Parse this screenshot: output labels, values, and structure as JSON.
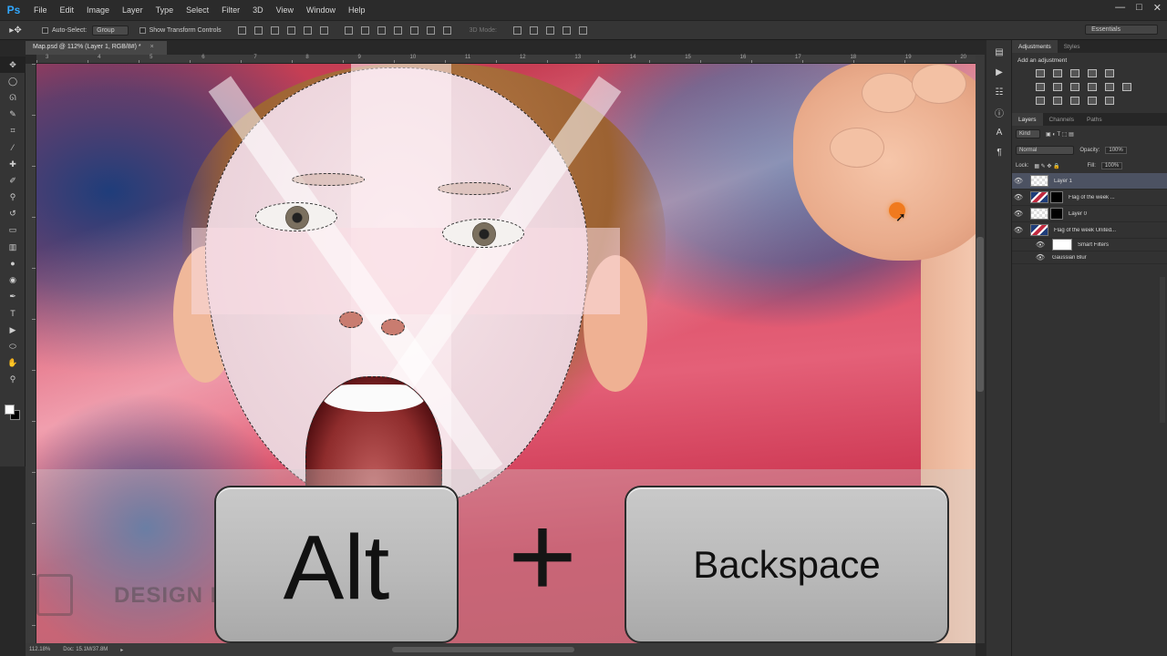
{
  "app": {
    "logo": "Ps"
  },
  "menu": [
    "File",
    "Edit",
    "Image",
    "Layer",
    "Type",
    "Select",
    "Filter",
    "3D",
    "View",
    "Window",
    "Help"
  ],
  "window_controls": [
    "—",
    "□",
    "✕"
  ],
  "options": {
    "auto_select_label": "Auto-Select:",
    "auto_select_value": "Group",
    "show_transform_label": "Show Transform Controls",
    "mode_3d_label": "3D Mode:",
    "workspace": "Essentials"
  },
  "document": {
    "tab_title": "Map.psd @ 112% (Layer 1, RGB/8#) *",
    "tab_close": "×"
  },
  "ruler": {
    "numbers": [
      "3",
      "4",
      "5",
      "6",
      "7",
      "8",
      "9",
      "10",
      "11",
      "12",
      "13",
      "14",
      "15",
      "16",
      "17",
      "18",
      "19",
      "20"
    ]
  },
  "status": {
    "zoom": "112.18%",
    "doc": "Doc: 15.1M/37.8M"
  },
  "overlay": {
    "key1": "Alt",
    "plus": "+",
    "key2": "Backspace",
    "watermark": "DESIGN RESOURCES"
  },
  "adjustments_panel": {
    "tabs": [
      "Adjustments",
      "Styles"
    ],
    "title": "Add an adjustment"
  },
  "layers_panel": {
    "tabs": [
      "Layers",
      "Channels",
      "Paths"
    ],
    "filter_kind": "Kind",
    "blend_mode": "Normal",
    "opacity_label": "Opacity:",
    "opacity_value": "100%",
    "lock_label": "Lock:",
    "fill_label": "Fill:",
    "fill_value": "100%",
    "layers": [
      {
        "name": "Layer 1",
        "selected": true
      },
      {
        "name": "Flag of the week ...",
        "selected": false
      },
      {
        "name": "Layer 0",
        "selected": false
      },
      {
        "name": "Flag of the week United...",
        "selected": false
      }
    ],
    "smart_filters_label": "Smart Filters",
    "gaussian_blur_label": "Gaussian Blur"
  },
  "colors": {
    "accent_ps": "#31a8ff",
    "selected_layer": "#4c5262",
    "cursor_highlight": "#f07a1e",
    "flag_red": "#c23c52",
    "flag_blue": "#1f3d7a"
  },
  "icons": [
    "move-tool-icon",
    "marquee-tool-icon",
    "lasso-tool-icon",
    "quick-select-icon",
    "crop-tool-icon",
    "eyedropper-icon",
    "brush-icon",
    "stamp-icon",
    "eraser-icon",
    "gradient-icon",
    "pen-icon",
    "type-icon",
    "hand-icon",
    "zoom-icon",
    "eye-icon"
  ]
}
